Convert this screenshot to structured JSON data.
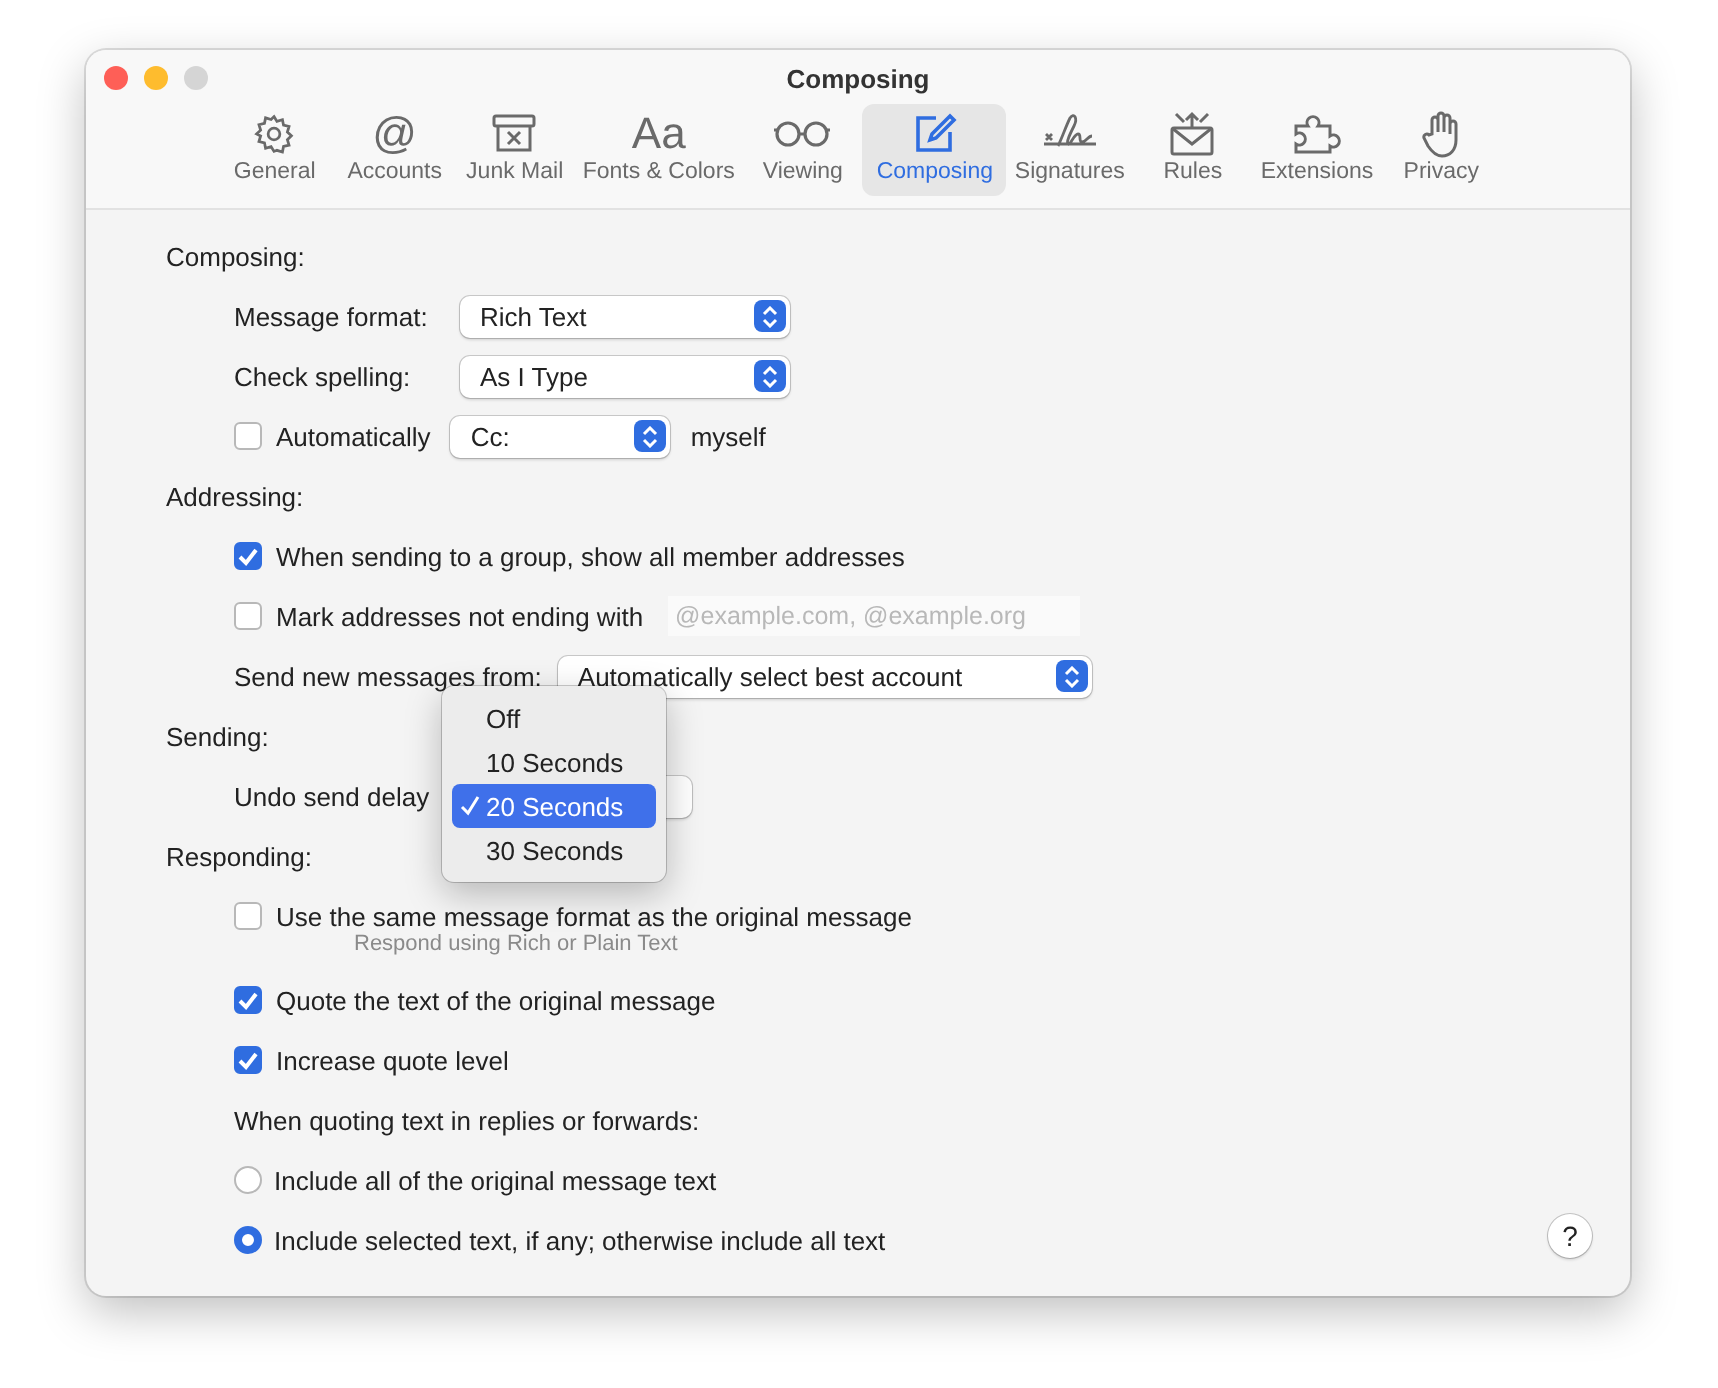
{
  "window": {
    "title": "Composing"
  },
  "toolbar": [
    {
      "label": "General",
      "selected": false
    },
    {
      "label": "Accounts",
      "selected": false,
      "glyph": "@"
    },
    {
      "label": "Junk Mail",
      "selected": false
    },
    {
      "label": "Fonts & Colors",
      "selected": false,
      "glyph": "Aa"
    },
    {
      "label": "Viewing",
      "selected": false
    },
    {
      "label": "Composing",
      "selected": true
    },
    {
      "label": "Signatures",
      "selected": false
    },
    {
      "label": "Rules",
      "selected": false
    },
    {
      "label": "Extensions",
      "selected": false
    },
    {
      "label": "Privacy",
      "selected": false
    }
  ],
  "rows": [
    {
      "kind": "heading",
      "label": "Composing:"
    },
    {
      "kind": "popup",
      "label": "Message format:",
      "value": "Rich Text"
    },
    {
      "kind": "popup",
      "label": "Check spelling:",
      "value": "As I Type"
    },
    {
      "kind": "checkbox_popup",
      "label": "Automatically",
      "checked": false,
      "value": "Cc:",
      "suffix": "myself"
    },
    {
      "kind": "heading",
      "label": "Addressing:"
    },
    {
      "kind": "checkbox",
      "label": "When sending to a group, show all member addresses",
      "checked": true
    },
    {
      "kind": "checkbox_field",
      "label": "Mark addresses not ending with",
      "checked": false,
      "placeholder": "@example.com, @example.org"
    },
    {
      "kind": "wide_popup",
      "label": "Send new messages from:",
      "value": "Automatically select best account"
    },
    {
      "kind": "heading",
      "label": "Sending:"
    },
    {
      "kind": "covered_popup",
      "label": "Undo send delay"
    },
    {
      "kind": "heading",
      "label": "Responding:"
    },
    {
      "kind": "checkbox",
      "label": "Use the same message format as the original message",
      "checked": false,
      "note": "Respond using Rich or Plain Text"
    },
    {
      "kind": "checkbox",
      "label": "Quote the text of the original message",
      "checked": true
    },
    {
      "kind": "checkbox",
      "label": "Increase quote level",
      "checked": true
    },
    {
      "kind": "text",
      "label": "When quoting text in replies or forwards:"
    },
    {
      "kind": "radio",
      "label": "Include all of the original message text",
      "selected": false
    },
    {
      "kind": "radio",
      "label": "Include selected text, if any; otherwise include all text",
      "selected": true
    }
  ],
  "menu": [
    {
      "label": "Off",
      "selected": false
    },
    {
      "label": "10 Seconds",
      "selected": false
    },
    {
      "label": "20 Seconds",
      "selected": true
    },
    {
      "label": "30 Seconds",
      "selected": false
    }
  ],
  "help_button": "?"
}
